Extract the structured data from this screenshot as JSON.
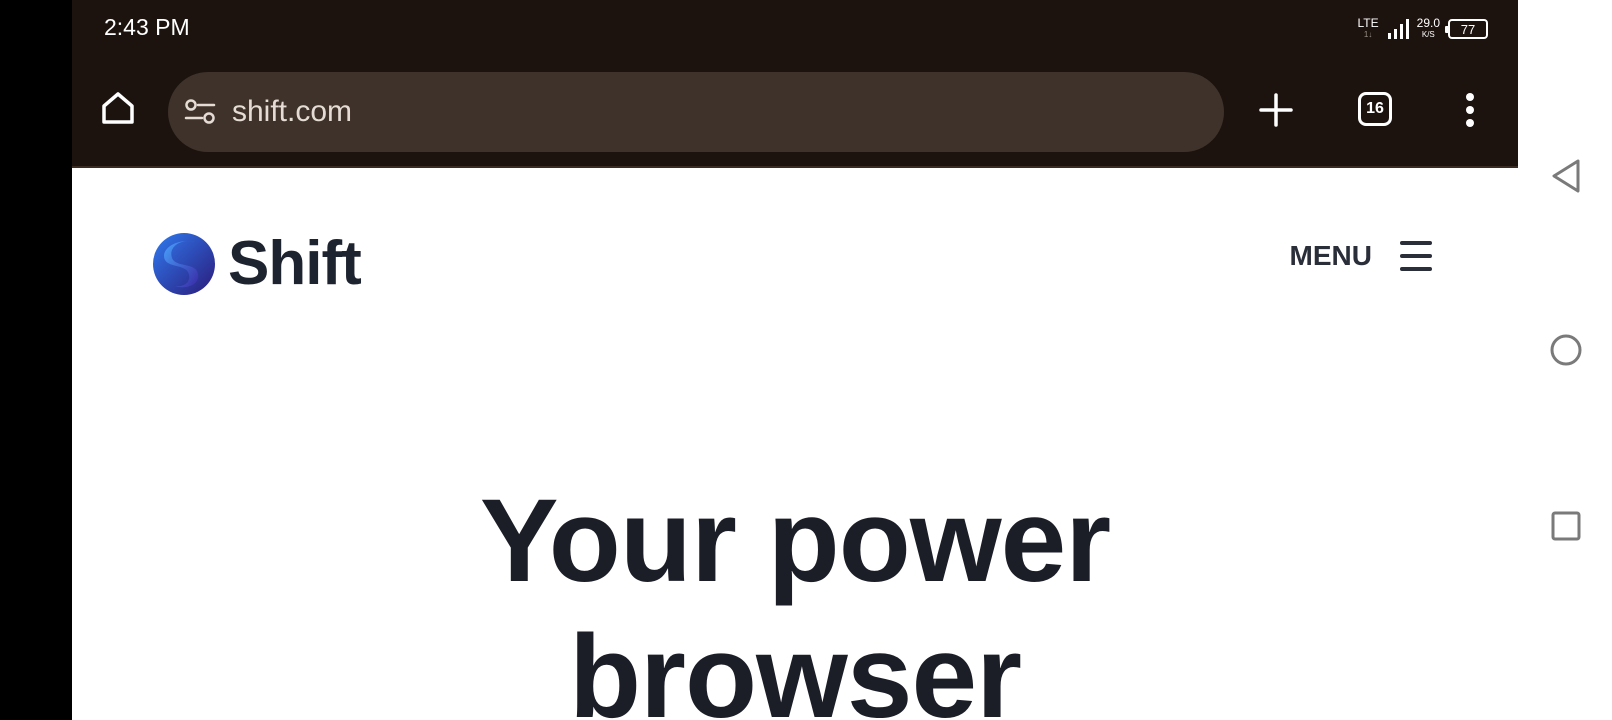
{
  "status_bar": {
    "time": "2:43 PM",
    "network": "LTE",
    "network_sub": "1↓",
    "speed_value": "29.0",
    "speed_unit": "K/S",
    "battery": "77"
  },
  "toolbar": {
    "url": "shift.com",
    "tab_count": "16"
  },
  "site": {
    "logo_text": "Shift",
    "menu_label": "MENU",
    "hero_line1": "Your power",
    "hero_line2": "browser"
  },
  "colors": {
    "chrome_bg": "#1c130e",
    "url_bar_bg": "#3f322a",
    "heading": "#1b1e27",
    "logo_blue": "#2d6be0",
    "logo_purple": "#3a1f8f"
  },
  "icons": {
    "home": "home-icon",
    "site_info": "site-settings-icon",
    "new_tab": "plus-icon",
    "overflow": "more-vert-icon",
    "menu": "hamburger-icon",
    "back": "back-triangle-icon",
    "home_nav": "home-circle-icon",
    "recents": "recents-square-icon"
  }
}
